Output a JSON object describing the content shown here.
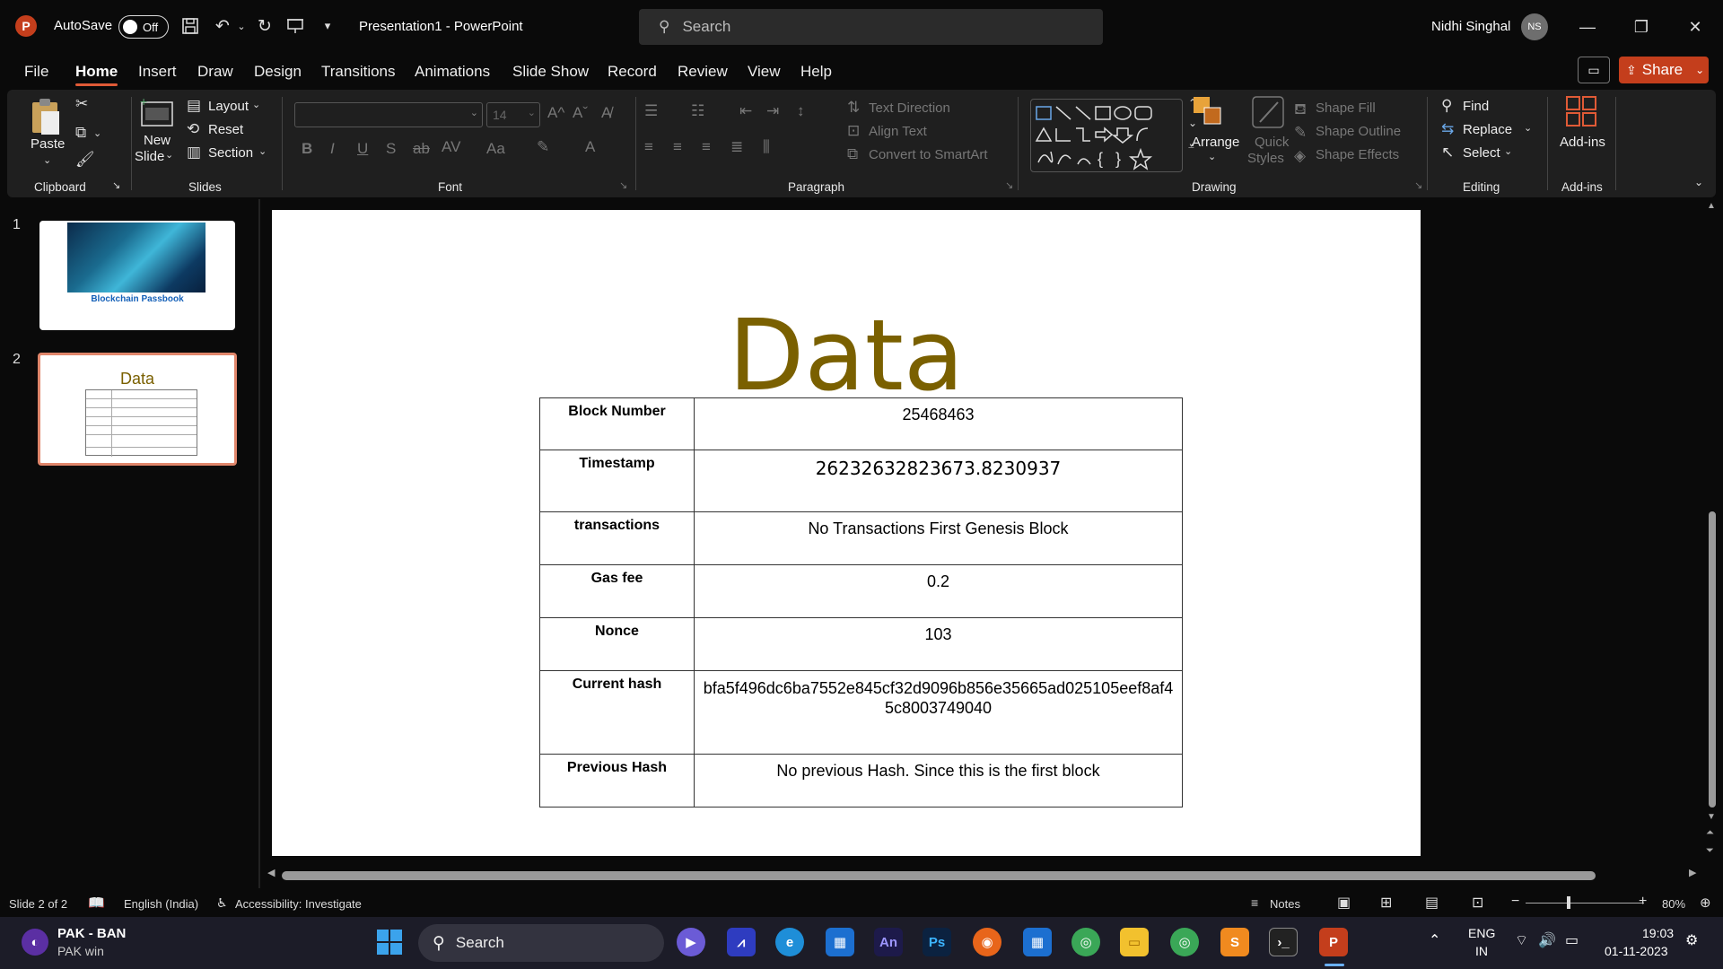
{
  "titlebar": {
    "autosave_label": "AutoSave",
    "autosave_state": "Off",
    "document_title": "Presentation1  -  PowerPoint",
    "search_placeholder": "Search",
    "user_name": "Nidhi Singhal",
    "user_initials": "NS"
  },
  "tabs": [
    "File",
    "Home",
    "Insert",
    "Draw",
    "Design",
    "Transitions",
    "Animations",
    "Slide Show",
    "Record",
    "Review",
    "View",
    "Help"
  ],
  "active_tab": "Home",
  "share_label": "Share",
  "ribbon": {
    "clipboard": {
      "label": "Clipboard",
      "paste": "Paste"
    },
    "slides": {
      "label": "Slides",
      "new_slide_1": "New",
      "new_slide_2": "Slide",
      "layout": "Layout",
      "reset": "Reset",
      "section": "Section"
    },
    "font": {
      "label": "Font",
      "size": "14"
    },
    "paragraph": {
      "label": "Paragraph",
      "text_direction": "Text Direction",
      "align_text": "Align Text",
      "convert_smartart": "Convert to SmartArt"
    },
    "drawing": {
      "label": "Drawing",
      "arrange": "Arrange",
      "quick_styles_1": "Quick",
      "quick_styles_2": "Styles",
      "shape_fill": "Shape Fill",
      "shape_outline": "Shape Outline",
      "shape_effects": "Shape Effects"
    },
    "editing": {
      "label": "Editing",
      "find": "Find",
      "replace": "Replace",
      "select": "Select"
    },
    "addins": {
      "label": "Add-ins",
      "button": "Add-ins"
    }
  },
  "thumbnails": [
    {
      "number": "1",
      "caption": "Blockchain Passbook"
    },
    {
      "number": "2",
      "caption": "Data"
    }
  ],
  "slide": {
    "title": "Data",
    "rows": [
      {
        "key": "Block Number",
        "value": "25468463"
      },
      {
        "key": "Timestamp",
        "value": "26232632823673.8230937"
      },
      {
        "key": "transactions",
        "value": "No Transactions First Genesis Block"
      },
      {
        "key": "Gas fee",
        "value": "0.2"
      },
      {
        "key": "Nonce",
        "value": "103"
      },
      {
        "key": "Current hash",
        "value": "bfa5f496dc6ba7552e845cf32d9096b856e35665ad025105eef8af45c8003749040"
      },
      {
        "key": "Previous Hash",
        "value": "No previous Hash. Since this is the first block"
      }
    ]
  },
  "statusbar": {
    "slide_counter": "Slide 2 of 2",
    "language": "English (India)",
    "accessibility": "Accessibility: Investigate",
    "notes": "Notes",
    "zoom": "80%"
  },
  "taskbar": {
    "weather_title": "PAK - BAN",
    "weather_sub": "PAK win",
    "search": "Search",
    "lang_1": "ENG",
    "lang_2": "IN",
    "time": "19:03",
    "date": "01-11-2023"
  },
  "colors": {
    "accent": "#c43e1c",
    "slide_title": "#7a6000",
    "tab_underline": "#e05a36"
  }
}
